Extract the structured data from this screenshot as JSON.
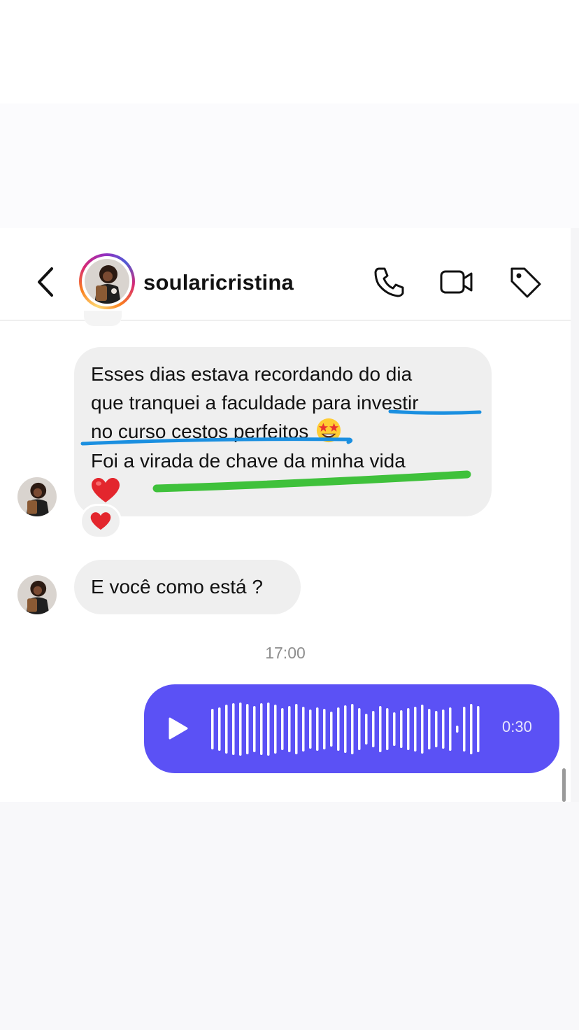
{
  "header": {
    "username": "soularicristina"
  },
  "icons": {
    "back": "chevron-left-icon",
    "call": "phone-icon",
    "video": "video-camera-icon",
    "tag": "tag-icon",
    "play": "play-icon",
    "heart": "red-heart-emoji",
    "star_struck": "star-struck-emoji"
  },
  "messages": [
    {
      "lines": [
        "Esses dias estava recordando do dia",
        "que tranquei a faculdade para investir",
        "no curso cestos perfeitos",
        "Foi a virada de chave da minha vida"
      ]
    },
    {
      "lines": [
        "E você como está ?"
      ]
    }
  ],
  "timestamp": "17:00",
  "voice_message": {
    "duration": "0:30"
  },
  "colors": {
    "voice_bubble": "#5b51f5",
    "incoming_bubble": "#efefef",
    "underline_blue": "#1a8fe0",
    "underline_green": "#3fc13b"
  }
}
